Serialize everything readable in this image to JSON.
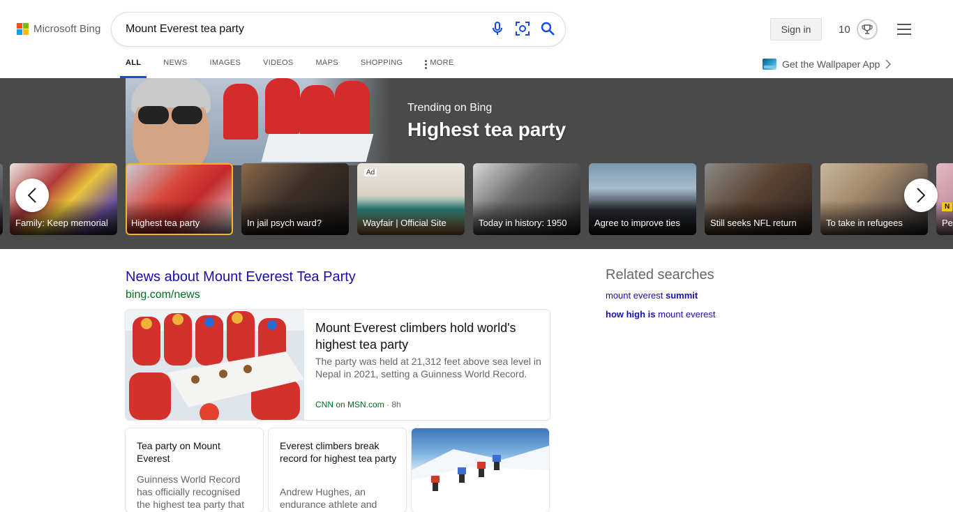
{
  "header": {
    "logo_text": "Microsoft Bing",
    "logo_colors": [
      "#f25022",
      "#7fba00",
      "#00a4ef",
      "#ffb900"
    ],
    "search_value": "Mount Everest tea party",
    "signin_label": "Sign in",
    "points": "10",
    "wallpaper_label": "Get the Wallpaper App"
  },
  "tabs": [
    {
      "label": "ALL",
      "active": true
    },
    {
      "label": "NEWS"
    },
    {
      "label": "IMAGES"
    },
    {
      "label": "VIDEOS"
    },
    {
      "label": "MAPS"
    },
    {
      "label": "SHOPPING"
    },
    {
      "label": "MORE"
    }
  ],
  "trending": {
    "label": "Trending on Bing",
    "title": "Highest tea party",
    "cards": [
      {
        "caption": "Family: Keep memorial"
      },
      {
        "caption": "Highest tea party",
        "selected": true
      },
      {
        "caption": "In jail psych ward?"
      },
      {
        "caption": "Wayfair | Official Site",
        "badge": "Ad"
      },
      {
        "caption": "Today in history: 1950"
      },
      {
        "caption": "Agree to improve ties"
      },
      {
        "caption": "Still seeks NFL return"
      },
      {
        "caption": "To take in refugees"
      },
      {
        "caption": "Pe",
        "badge": "N"
      }
    ]
  },
  "news": {
    "title": "News about Mount Everest Tea Party",
    "source": "bing.com/news",
    "main": {
      "title": "Mount Everest climbers hold world's highest tea party",
      "snippet": "The party was held at 21,312 feet above sea level in Nepal in 2021, setting a Guinness World Record.",
      "source": "CNN on MSN.com",
      "age": "· 8h"
    },
    "cards": [
      {
        "title": "Tea party on Mount Everest",
        "snippet": "Guinness World Record has officially recognised the highest tea party that"
      },
      {
        "title": "Everest climbers break record for highest tea party",
        "snippet": "Andrew Hughes, an endurance athlete and"
      }
    ]
  },
  "related": {
    "title": "Related searches",
    "items": [
      {
        "plain": "mount everest ",
        "bold": "summit"
      },
      {
        "bold": "how high is",
        "plain": " mount everest"
      }
    ]
  }
}
